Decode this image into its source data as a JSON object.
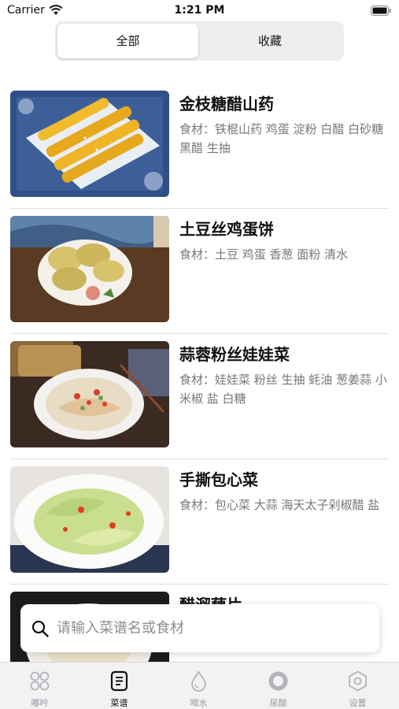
{
  "status_bar": {
    "carrier": "Carrier",
    "time": "1:21 PM"
  },
  "segmented": {
    "all": "全部",
    "favorites": "收藏",
    "selected": "全部"
  },
  "recipes": [
    {
      "title": "金枝糖醋山药",
      "ingredients": "食材：铁棍山药 鸡蛋 淀粉 白醋 白砂糖 黑醋 生抽"
    },
    {
      "title": "土豆丝鸡蛋饼",
      "ingredients": "食材：土豆 鸡蛋 香葱 面粉 清水"
    },
    {
      "title": "蒜蓉粉丝娃娃菜",
      "ingredients": "食材：娃娃菜 粉丝 生抽 蚝油 葱姜蒜 小米椒 盐 白糖"
    },
    {
      "title": "手撕包心菜",
      "ingredients": "食材：包心菜 大蒜 海天太子剁椒醋 盐"
    },
    {
      "title": "醋溜藕片",
      "ingredients": ""
    }
  ],
  "search": {
    "placeholder": "请输入菜谱名或食材"
  },
  "tabs": [
    {
      "label": "嘟吟",
      "icon": "grid-icon"
    },
    {
      "label": "菜谱",
      "icon": "recipe-book-icon"
    },
    {
      "label": "喝水",
      "icon": "water-drop-icon"
    },
    {
      "label": "尿酸",
      "icon": "circle-icon"
    },
    {
      "label": "设置",
      "icon": "hexagon-settings-icon"
    }
  ],
  "active_tab": "菜谱",
  "colors": {
    "accent": "#111111",
    "inactive_tab": "#9a9a9f",
    "ingredient_text": "#777777"
  }
}
